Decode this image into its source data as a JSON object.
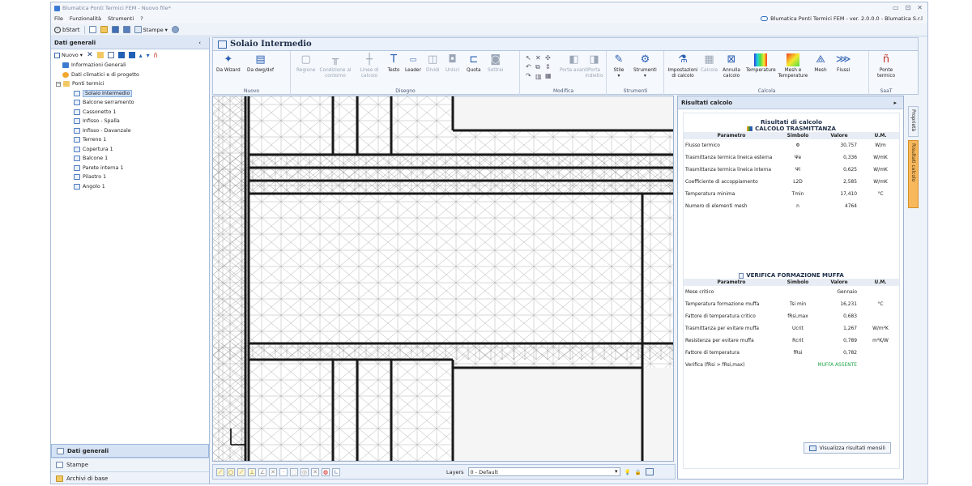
{
  "window": {
    "title": "Blumatica Ponti Termici FEM - Nuovo file*",
    "version_label": "Blumatica Ponti Termici FEM - ver. 2.0.0.0 - Blumatica S.r.l"
  },
  "menu": [
    "File",
    "Funzionalità",
    "Strumenti",
    "?"
  ],
  "quickbar": {
    "bstart": "bStart",
    "stampe": "Stampe"
  },
  "left_panel": {
    "header": "Dati generali",
    "collapse": "‹",
    "new_label": "Nuovo",
    "tree": {
      "info": "Informazioni Generali",
      "climate": "Dati climatici e di progetto",
      "root": "Ponti termici",
      "children": [
        "Solaio Intermedio",
        "Balcone serramento",
        "Cassonetto 1",
        "Infisso - Spalla",
        "Infisso - Davanzale",
        "Terreno 1",
        "Copertura 1",
        "Balcone 1",
        "Parete interna 1",
        "Pilastro 1",
        "Angolo 1"
      ]
    },
    "bottom": [
      "Dati generali",
      "Stampe",
      "Archivi di base"
    ]
  },
  "document": {
    "title": "Solaio Intermedio"
  },
  "ribbon": {
    "groups": [
      {
        "label": "Nuovo",
        "buttons": [
          "Da Wizard",
          "Da dwg/dxf"
        ]
      },
      {
        "label": "Disegno",
        "buttons": [
          "Regione",
          "Condizione al contorno",
          "Linee di calcolo",
          "Testo",
          "Leader",
          "Dividi",
          "Unisci",
          "Quota",
          "Sottrai"
        ]
      },
      {
        "label": "Modifica",
        "buttons": [
          "Porta avanti",
          "Porta indietro"
        ]
      },
      {
        "label": "Strumenti",
        "buttons": [
          "Stile",
          "Strumenti"
        ]
      },
      {
        "label": "Calcola",
        "buttons": [
          "Impostazioni di calcolo",
          "Calcola",
          "Annulla calcolo",
          "Temperature",
          "Mesh e Temperature",
          "Mesh",
          "Flussi"
        ]
      },
      {
        "label": "SaaT",
        "buttons": [
          "Ponte termico"
        ]
      }
    ]
  },
  "bottom_bar": {
    "layers_label": "Layers",
    "layer_value": "0 - Default"
  },
  "results": {
    "header": "Risultati calcolo",
    "title": "Risultati di calcolo",
    "trasm_title": "CALCOLO TRASMITTANZA",
    "columns": [
      "Parametro",
      "Simbolo",
      "Valore",
      "U.M."
    ],
    "trasm_rows": [
      {
        "p": "Flusso termico",
        "s": "Φ",
        "v": "30,757",
        "u": "W/m"
      },
      {
        "p": "Trasmittanza termica lineica esterna",
        "s": "Ψe",
        "v": "0,336",
        "u": "W/mK"
      },
      {
        "p": "Trasmittanza termica lineica interna",
        "s": "Ψi",
        "v": "0,625",
        "u": "W/mK"
      },
      {
        "p": "Coefficiente di accoppiamento",
        "s": "L2D",
        "v": "2,585",
        "u": "W/mK"
      },
      {
        "p": "Temperatura minima",
        "s": "Tmin",
        "v": "17,410",
        "u": "°C"
      },
      {
        "p": "Numero di elementi mesh",
        "s": "n",
        "v": "4764",
        "u": ""
      }
    ],
    "muffa_title": "VERIFICA FORMAZIONE MUFFA",
    "muffa_rows": [
      {
        "p": "Mese critico",
        "s": "",
        "v": "Gennaio",
        "u": ""
      },
      {
        "p": "Temperatura formazione muffa",
        "s": "Tsi min",
        "v": "16,231",
        "u": "°C"
      },
      {
        "p": "Fattore di temperatura critico",
        "s": "fRsi,max",
        "v": "0,683",
        "u": ""
      },
      {
        "p": "Trasmittanza per evitare muffa",
        "s": "Ucrit",
        "v": "1,267",
        "u": "W/m²K"
      },
      {
        "p": "Resistenza per evitare muffa",
        "s": "Rcrit",
        "v": "0,789",
        "u": "m²K/W"
      },
      {
        "p": "Fattore di temperatura",
        "s": "fRsi",
        "v": "0,782",
        "u": ""
      },
      {
        "p": "Verifica (fRsi > fRsi,max)",
        "s": "",
        "v": "MUFFA ASSENTE",
        "u": ""
      }
    ],
    "monthly_button": "Visualizza risultati mensili"
  },
  "side_tabs": [
    "Proprietà",
    "Risultati calcolo"
  ],
  "colors": {
    "accent": "#f8b85c",
    "ok": "#1ea64a",
    "panel": "#dce6f4"
  }
}
